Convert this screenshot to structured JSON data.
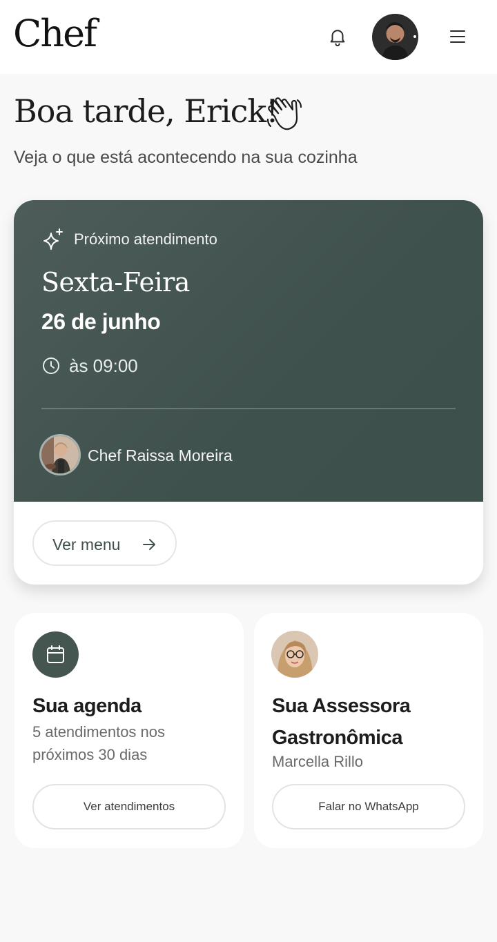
{
  "header": {
    "logo": "Chef",
    "bell_icon": "bell-icon",
    "avatar_icon": "user-avatar",
    "menu_icon": "hamburger-menu-icon"
  },
  "greeting": {
    "title": "Boa tarde, Erick!",
    "emoji_icon": "waving-hand-icon",
    "subtitle": "Veja o que está acontecendo na sua cozinha"
  },
  "next_appointment": {
    "label": "Próximo atendimento",
    "icon": "sparkle-icon",
    "weekday": "Sexta-Feira",
    "date": "26 de junho",
    "time": "às 09:00",
    "chef_name": "Chef Raissa Moreira",
    "menu_button": "Ver menu",
    "colors": {
      "card_bg": "#3f514d",
      "accent": "#455651"
    }
  },
  "agenda": {
    "title": "Sua agenda",
    "description": "5 atendimentos nos próximos 30 dias",
    "button": "Ver atendimentos",
    "icon": "calendar-icon"
  },
  "advisor": {
    "title": "Sua Assessora Gastronômica",
    "name": "Marcella Rillo",
    "button": "Falar no WhatsApp"
  }
}
